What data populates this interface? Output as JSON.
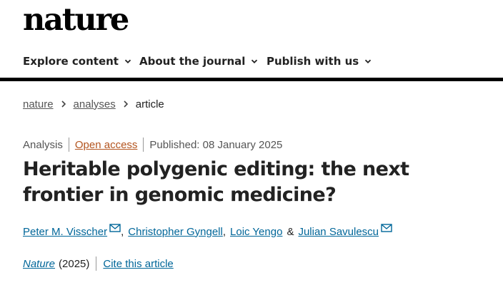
{
  "header": {
    "logo": "nature"
  },
  "nav": {
    "items": [
      {
        "label": "Explore content",
        "icon": "chevron-down-icon"
      },
      {
        "label": "About the journal",
        "icon": "chevron-down-icon"
      },
      {
        "label": "Publish with us",
        "icon": "chevron-down-icon"
      }
    ]
  },
  "breadcrumb": {
    "items": [
      "nature",
      "analyses",
      "article"
    ]
  },
  "article": {
    "type": "Analysis",
    "access": "Open access",
    "published": "Published: 08 January 2025",
    "title": "Heritable polygenic editing: the next frontier in genomic medicine?",
    "authors": [
      {
        "name": "Peter M. Visscher",
        "has_email": true
      },
      {
        "name": "Christopher Gyngell",
        "has_email": false
      },
      {
        "name": "Loic Yengo",
        "has_email": false
      },
      {
        "name": "Julian Savulescu",
        "has_email": true
      }
    ],
    "author_sep_comma": ",",
    "author_sep_and": "&",
    "journal": "Nature",
    "year": "(2025)",
    "cite_label": "Cite this article"
  },
  "colors": {
    "link": "#006699",
    "open_access": "#b3541e",
    "rule": "#000000"
  }
}
